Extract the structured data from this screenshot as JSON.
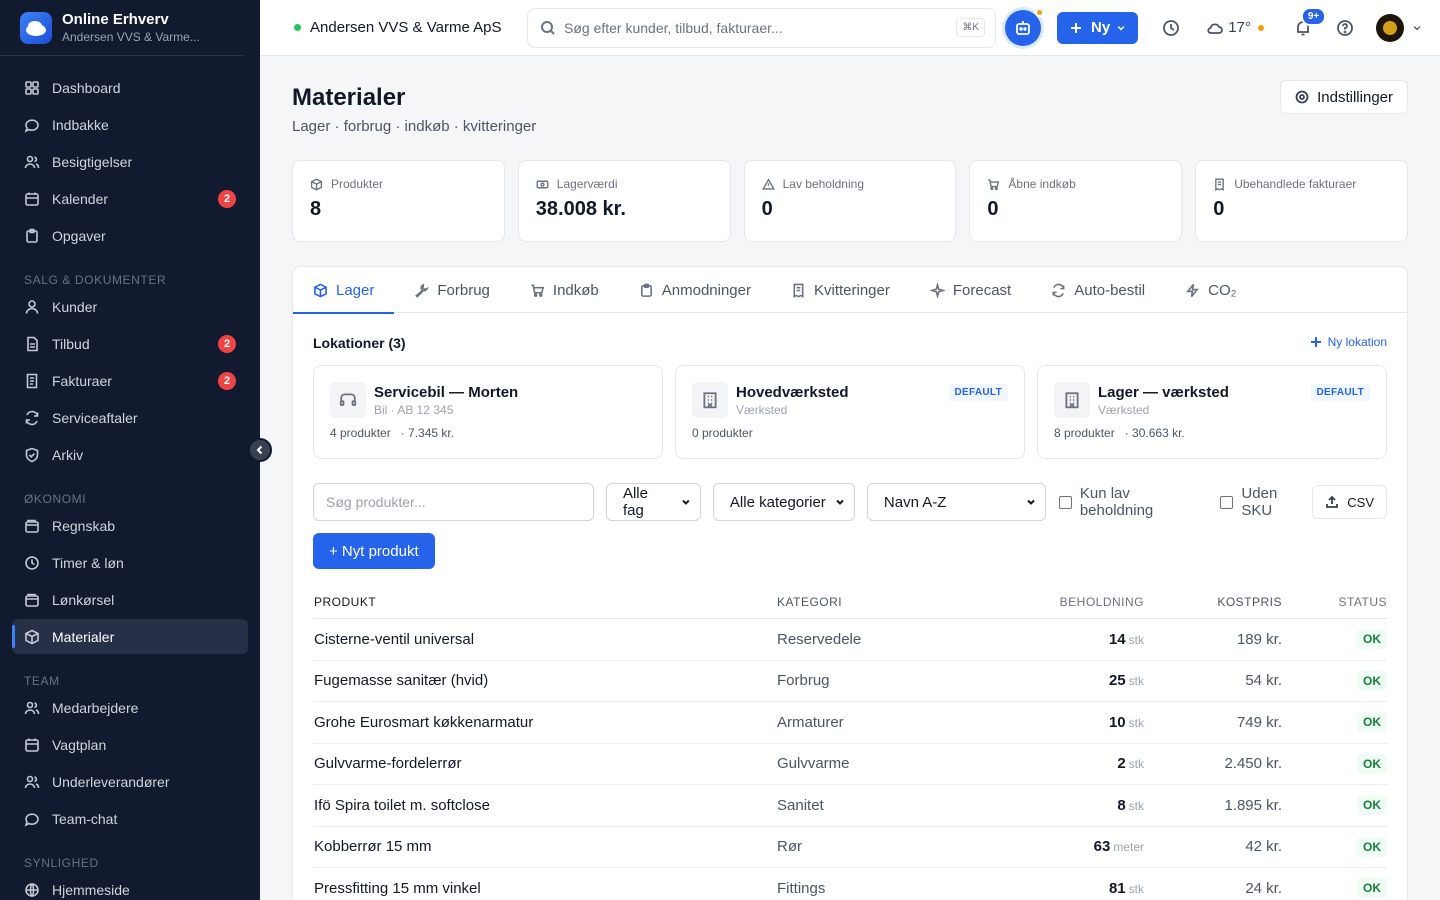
{
  "brand": {
    "title": "Online Erhverv",
    "subtitle": "Andersen VVS & Varme..."
  },
  "sidebar": {
    "items_top": [
      {
        "label": "Dashboard",
        "icon": "grid-icon"
      },
      {
        "label": "Indbakke",
        "icon": "chat-icon"
      },
      {
        "label": "Besigtigelser",
        "icon": "users-icon"
      },
      {
        "label": "Kalender",
        "icon": "calendar-icon",
        "badge": "2"
      },
      {
        "label": "Opgaver",
        "icon": "clipboard-icon"
      }
    ],
    "section_sales": "SALG & DOKUMENTER",
    "items_sales": [
      {
        "label": "Kunder",
        "icon": "user-icon"
      },
      {
        "label": "Tilbud",
        "icon": "document-icon",
        "badge": "2"
      },
      {
        "label": "Fakturaer",
        "icon": "invoice-icon",
        "badge": "2"
      },
      {
        "label": "Serviceaftaler",
        "icon": "refresh-icon"
      },
      {
        "label": "Arkiv",
        "icon": "shield-icon"
      }
    ],
    "section_economy": "ØKONOMI",
    "items_economy": [
      {
        "label": "Regnskab",
        "icon": "wallet-icon"
      },
      {
        "label": "Timer & løn",
        "icon": "clock-icon"
      },
      {
        "label": "Lønkørsel",
        "icon": "wallet-icon"
      },
      {
        "label": "Materialer",
        "icon": "box-icon",
        "active": true
      }
    ],
    "section_team": "TEAM",
    "items_team": [
      {
        "label": "Medarbejdere",
        "icon": "users-icon"
      },
      {
        "label": "Vagtplan",
        "icon": "calendar-icon"
      },
      {
        "label": "Underleverandører",
        "icon": "users-icon"
      },
      {
        "label": "Team-chat",
        "icon": "chat-icon"
      }
    ],
    "section_synlighed": "SYNLIGHED",
    "items_synlighed": [
      {
        "label": "Hjemmeside",
        "icon": "globe-icon"
      }
    ]
  },
  "topbar": {
    "company": "Andersen VVS & Varme ApS",
    "search_placeholder": "Søg efter kunder, tilbud, fakturaer...",
    "search_shortcut": "⌘K",
    "new_label": "Ny",
    "weather": "17°",
    "notifications": "9+"
  },
  "page": {
    "title": "Materialer",
    "subtitle": "Lager · forbrug · indkøb · kvitteringer",
    "settings_label": "Indstillinger"
  },
  "stats": [
    {
      "label": "Produkter",
      "value": "8",
      "icon": "box-icon"
    },
    {
      "label": "Lagerværdi",
      "value": "38.008 kr.",
      "icon": "money-icon"
    },
    {
      "label": "Lav beholdning",
      "value": "0",
      "icon": "warning-icon"
    },
    {
      "label": "Åbne indkøb",
      "value": "0",
      "icon": "cart-icon"
    },
    {
      "label": "Ubehandlede fakturaer",
      "value": "0",
      "icon": "receipt-icon"
    }
  ],
  "tabs": [
    {
      "label": "Lager",
      "icon": "box-icon",
      "active": true
    },
    {
      "label": "Forbrug",
      "icon": "wrench-icon"
    },
    {
      "label": "Indkøb",
      "icon": "cart-icon"
    },
    {
      "label": "Anmodninger",
      "icon": "clipboard-icon"
    },
    {
      "label": "Kvitteringer",
      "icon": "receipt-icon"
    },
    {
      "label": "Forecast",
      "icon": "sparkle-icon"
    },
    {
      "label": "Auto-bestil",
      "icon": "refresh-icon"
    },
    {
      "label": "CO₂",
      "icon": "bolt-icon"
    }
  ],
  "locations": {
    "heading": "Lokationer (3)",
    "add_label": "Ny lokation",
    "items": [
      {
        "name": "Servicebil — Morten",
        "type": "Bil · AB 12 345",
        "count": "4 produkter",
        "value": "· 7.345 kr.",
        "icon": "truck-icon",
        "default": ""
      },
      {
        "name": "Hovedværksted",
        "type": "Værksted",
        "count": "0 produkter",
        "value": "",
        "icon": "building-icon",
        "default": "DEFAULT"
      },
      {
        "name": "Lager — værksted",
        "type": "Værksted",
        "count": "8 produkter",
        "value": "· 30.663 kr.",
        "icon": "building-icon",
        "default": "DEFAULT"
      }
    ]
  },
  "filters": {
    "search_placeholder": "Søg produkter...",
    "fag": "Alle fag",
    "kategori": "Alle kategorier",
    "sort": "Navn A-Z",
    "low_stock": "Kun lav beholdning",
    "no_sku": "Uden SKU",
    "csv": "CSV",
    "new_product": "+ Nyt produkt"
  },
  "table": {
    "headers": {
      "product": "PRODUKT",
      "category": "KATEGORI",
      "stock": "BEHOLDNING",
      "cost": "KOSTPRIS",
      "status": "STATUS"
    },
    "rows": [
      {
        "product": "Cisterne-ventil universal",
        "category": "Reservedele",
        "qty": "14",
        "unit": "stk",
        "cost": "189 kr.",
        "status": "OK"
      },
      {
        "product": "Fugemasse sanitær (hvid)",
        "category": "Forbrug",
        "qty": "25",
        "unit": "stk",
        "cost": "54 kr.",
        "status": "OK"
      },
      {
        "product": "Grohe Eurosmart køkkenarmatur",
        "category": "Armaturer",
        "qty": "10",
        "unit": "stk",
        "cost": "749 kr.",
        "status": "OK"
      },
      {
        "product": "Gulvvarme-fordelerrør",
        "category": "Gulvvarme",
        "qty": "2",
        "unit": "stk",
        "cost": "2.450 kr.",
        "status": "OK"
      },
      {
        "product": "Ifö Spira toilet m. softclose",
        "category": "Sanitet",
        "qty": "8",
        "unit": "stk",
        "cost": "1.895 kr.",
        "status": "OK"
      },
      {
        "product": "Kobberrør 15 mm",
        "category": "Rør",
        "qty": "63",
        "unit": "meter",
        "cost": "42 kr.",
        "status": "OK"
      },
      {
        "product": "Pressfitting 15 mm vinkel",
        "category": "Fittings",
        "qty": "81",
        "unit": "stk",
        "cost": "24 kr.",
        "status": "OK"
      }
    ]
  },
  "colors": {
    "primary": "#2563eb",
    "sidebar_bg": "#111a2e",
    "badge": "#ef4444",
    "ok": "#15803d"
  }
}
